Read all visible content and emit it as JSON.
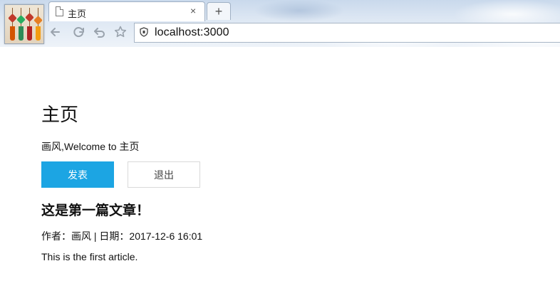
{
  "browser": {
    "tab_title": "主页",
    "tab_close": "×",
    "new_tab": "+",
    "address": "localhost:3000"
  },
  "page": {
    "title": "主页",
    "welcome": "画风,Welcome to 主页",
    "buttons": {
      "publish": "发表",
      "logout": "退出"
    },
    "article": {
      "title": "这是第一篇文章！",
      "meta": "作者：画风 | 日期：2017-12-6 16:01",
      "body": "This is the first article."
    }
  },
  "colors": {
    "primary_button": "#1ca5e3"
  },
  "icons": [
    "page-icon",
    "back-icon",
    "reload-icon",
    "history-back-icon",
    "favorite-star-icon",
    "shield-icon"
  ]
}
